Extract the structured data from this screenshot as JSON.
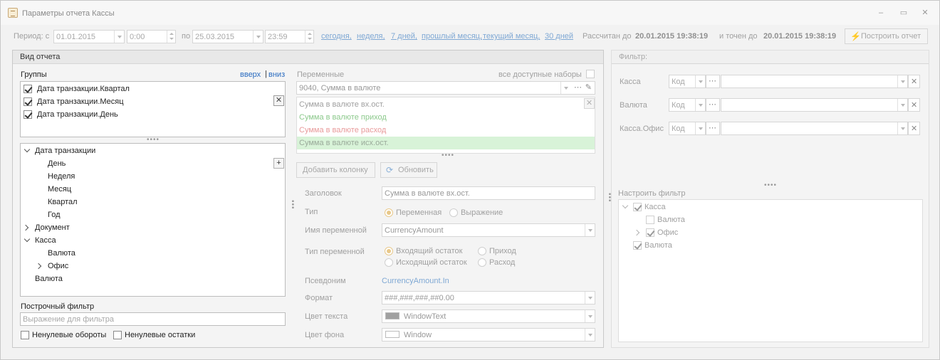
{
  "window": {
    "title": "Параметры отчета Кассы",
    "minimize_label": "–",
    "restore_label": "▭",
    "close_label": "✕"
  },
  "toolbar": {
    "period_label": "Период: с",
    "date_from": "01.01.2015",
    "time_from": "0:00",
    "to_label": "по",
    "date_to": "25.03.2015",
    "time_to": "23:59",
    "quick_periods": [
      "сегодня,",
      "неделя,",
      "7 дней,",
      "прошлый месяц,",
      "текущий месяц,",
      "30 дней"
    ],
    "calculated_label": "Рассчитан до",
    "calculated_value": "20.01.2015 19:38:19",
    "accurate_label": "и точен до",
    "accurate_value": "20.01.2015 19:38:19",
    "build_button": "Построить отчет"
  },
  "report_view": {
    "header": "Вид отчета",
    "groups_label": "Группы",
    "up_link": "вверх",
    "separator": "|",
    "down_link": "вниз",
    "groups": [
      {
        "label": "Дата транзакции.Квартал",
        "checked": true
      },
      {
        "label": "Дата транзакции.Месяц",
        "checked": true
      },
      {
        "label": "Дата транзакции.День",
        "checked": true
      }
    ],
    "tree": [
      {
        "label": "Дата транзакции",
        "expander": "open",
        "level": 0
      },
      {
        "label": "День",
        "expander": "none",
        "level": 1
      },
      {
        "label": "Неделя",
        "expander": "none",
        "level": 1
      },
      {
        "label": "Месяц",
        "expander": "none",
        "level": 1
      },
      {
        "label": "Квартал",
        "expander": "none",
        "level": 1
      },
      {
        "label": "Год",
        "expander": "none",
        "level": 1
      },
      {
        "label": "Документ",
        "expander": "closed",
        "level": 0
      },
      {
        "label": "Касса",
        "expander": "open",
        "level": 0
      },
      {
        "label": "Валюта",
        "expander": "none",
        "level": 1
      },
      {
        "label": "Офис",
        "expander": "closed",
        "level": 1
      },
      {
        "label": "Валюта",
        "expander": "none",
        "level": 0
      }
    ],
    "row_filter_label": "Построчный фильтр",
    "row_filter_placeholder": "Выражение для фильтра",
    "nonzero_turnover": "Ненулевые обороты",
    "nonzero_balances": "Ненулевые остатки"
  },
  "variables": {
    "label": "Переменные",
    "all_sets_label": "все доступные наборы",
    "selected_set": "9040, Сумма в валюте",
    "items": [
      {
        "label": "Сумма в валюте вх.ост.",
        "color": "#a0a0a0",
        "bg": ""
      },
      {
        "label": "Сумма в валюте приход",
        "color": "#8cc98c",
        "bg": ""
      },
      {
        "label": "Сумма в валюте расход",
        "color": "#e89a9a",
        "bg": ""
      },
      {
        "label": "Сумма в валюте исх.ост.",
        "color": "#9aaa9a",
        "bg": "#d8f3d8"
      }
    ],
    "add_column_button": "Добавить колонку",
    "refresh_button": "Обновить"
  },
  "properties": {
    "heading_label": "Заголовок",
    "heading_value": "Сумма в валюте вх.ост.",
    "type_label": "Тип",
    "type_options": [
      "Переменная",
      "Выражение"
    ],
    "type_selected": 0,
    "var_name_label": "Имя переменной",
    "var_name_value": "CurrencyAmount",
    "var_type_label": "Тип переменной",
    "var_type_options": [
      "Входящий остаток",
      "Приход",
      "Исходящий остаток",
      "Расход"
    ],
    "var_type_selected": 0,
    "alias_label": "Псевдоним",
    "alias_value": "CurrencyAmount.In",
    "format_label": "Формат",
    "format_value": "###,###,###,##0.00",
    "text_color_label": "Цвет текста",
    "text_color_value": "WindowText",
    "text_color_swatch": "#a0a0a0",
    "bg_color_label": "Цвет фона",
    "bg_color_value": "Window",
    "bg_color_swatch": "#ffffff"
  },
  "filter": {
    "header": "Фильтр:",
    "rows": [
      {
        "label": "Касса",
        "code": "Код"
      },
      {
        "label": "Валюта",
        "code": "Код"
      },
      {
        "label": "Касса.Офис",
        "code": "Код"
      }
    ],
    "setup_label": "Настроить фильтр",
    "tree": [
      {
        "label": "Касса",
        "expander": "open",
        "checked": true,
        "level": 0
      },
      {
        "label": "Валюта",
        "expander": "none",
        "checked": false,
        "level": 1
      },
      {
        "label": "Офис",
        "expander": "closed",
        "checked": true,
        "level": 1
      },
      {
        "label": "Валюта",
        "expander": "none",
        "checked": true,
        "level": 0
      }
    ]
  }
}
